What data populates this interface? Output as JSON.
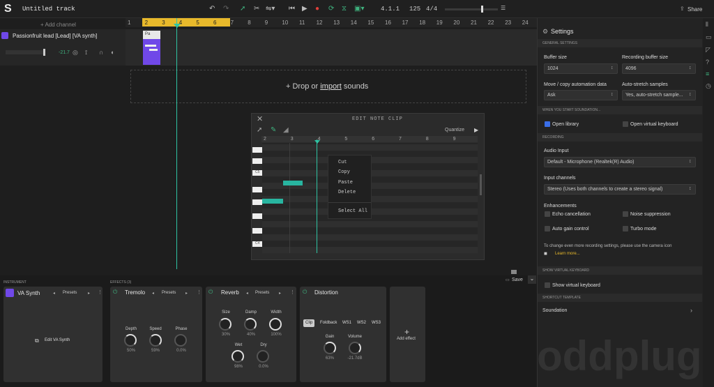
{
  "app": {
    "title": "Untitled track",
    "share": "Share",
    "bar": "4.1.1",
    "bpm": "125",
    "time_sig": "4/4"
  },
  "toolbar": {
    "icons": [
      "undo-icon",
      "redo-icon",
      "pencil-icon",
      "scissors-icon",
      "stretch-icon",
      "skip-back-icon",
      "play-icon",
      "record-icon",
      "loop-icon",
      "metronome-icon",
      "grid-icon"
    ]
  },
  "tracks": {
    "add_channel": "+ Add channel",
    "name": "Passionfruit lead [Lead] [VA synth]",
    "db": "-21.7",
    "clip_label": "Pa"
  },
  "ruler": {
    "numbers": [
      "1",
      "2",
      "3",
      "4",
      "5",
      "6",
      "7",
      "8",
      "9",
      "10",
      "11",
      "12",
      "13",
      "14",
      "15",
      "16",
      "17",
      "18",
      "19",
      "20",
      "21",
      "22",
      "23",
      "24"
    ]
  },
  "drop": {
    "prefix": "+ Drop or ",
    "link": "import",
    "suffix": " sounds"
  },
  "editor": {
    "title": "EDIT NOTE CLIP",
    "quantize": "Quantize",
    "numbers": [
      "2",
      "3",
      "4",
      "5",
      "6",
      "7",
      "8",
      "9"
    ],
    "key_c5": "C5",
    "key_c4": "C4"
  },
  "context_menu": [
    "Cut",
    "Copy",
    "Paste",
    "Delete",
    "Select All"
  ],
  "settings": {
    "title": "Settings",
    "general": "GENERAL SETTINGS",
    "buffer_label": "Buffer size",
    "buffer_value": "1024",
    "rec_buffer_label": "Recording buffer size",
    "rec_buffer_value": "4096",
    "automation_label": "Move / copy automation data",
    "automation_value": "Ask",
    "stretch_label": "Auto-stretch samples",
    "stretch_value": "Yes, auto-stretch sample...",
    "when_start": "WHEN YOU START SOUNDATION...",
    "open_library": "Open library",
    "open_vk": "Open virtual keyboard",
    "recording": "RECORDING",
    "audio_input_label": "Audio Input",
    "audio_input_value": "Default - Microphone (Realtek(R) Audio)",
    "input_channels_label": "Input channels",
    "input_channels_value": "Stereo (Uses both channels to create a stereo signal)",
    "enhancements": "Enhancements",
    "echo": "Echo cancellation",
    "noise": "Noise suppression",
    "agc": "Auto gain control",
    "turbo": "Turbo mode",
    "note": "To change even more recording settings, please use the camera icon",
    "learn_more": "Learn more...",
    "show_vk_head": "SHOW VIRTUAL KEYBOARD",
    "show_vk": "Show virtual keyboard",
    "shortcut_head": "SHORTCUT TEMPLATE",
    "shortcut_value": "Soundation"
  },
  "bottom": {
    "instrument_label": "INSTRUMENT",
    "effects_label": "EFFECTS (3)",
    "instrument": "VA Synth",
    "presets": "Presets",
    "edit_button": "Edit VA Synth",
    "save": "Save",
    "tremolo": {
      "name": "Tremolo",
      "depth": "Depth",
      "depth_v": "50%",
      "speed": "Speed",
      "speed_v": "59%",
      "phase": "Phase",
      "phase_v": "0.0%"
    },
    "reverb": {
      "name": "Reverb",
      "size": "Size",
      "size_v": "30%",
      "damp": "Damp",
      "damp_v": "40%",
      "width": "Width",
      "width_v": "100%",
      "wet": "Wet",
      "wet_v": "98%",
      "dry": "Dry",
      "dry_v": "0.0%"
    },
    "distortion": {
      "name": "Distortion",
      "modes": [
        "Clip",
        "Foldback",
        "WS1",
        "WS2",
        "WS3"
      ],
      "gain": "Gain",
      "gain_v": "63%",
      "volume": "Volume",
      "volume_v": "-21.7dB"
    },
    "add_effect": "Add effect"
  },
  "watermark": "oddplug"
}
